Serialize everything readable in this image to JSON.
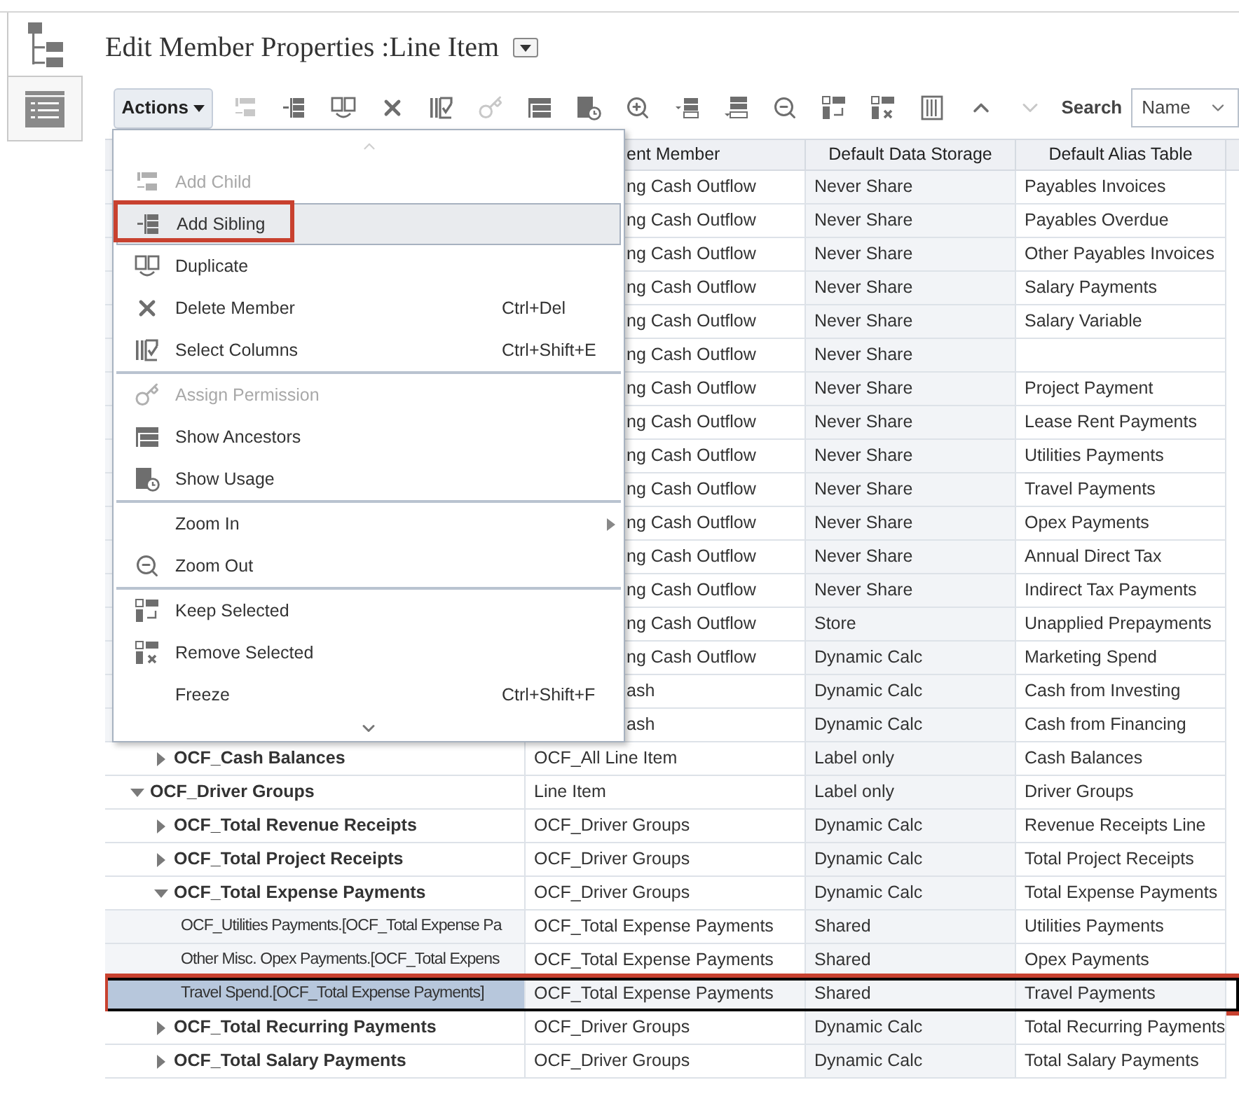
{
  "side_tabs": [
    {
      "selected": true
    },
    {
      "selected": false
    }
  ],
  "title": "Edit Member Properties :Line Item",
  "toolbar": {
    "actions": "Actions",
    "buttons": [
      {
        "disabled": true
      },
      {
        "disabled": false
      },
      {
        "disabled": false
      },
      {
        "disabled": false
      },
      {
        "disabled": false
      },
      {
        "disabled": true
      },
      {
        "disabled": false
      },
      {
        "disabled": false
      },
      {
        "disabled": false
      },
      {
        "disabled": false
      },
      {
        "disabled": false
      },
      {
        "disabled": false
      },
      {
        "disabled": false
      },
      {
        "disabled": false
      },
      {
        "disabled": false
      },
      {
        "disabled": false
      },
      {
        "disabled": true
      }
    ],
    "search_label": "Search",
    "search_by": "Name"
  },
  "table": {
    "columns": [
      "ent Member",
      "Default Data Storage",
      "Default Alias Table"
    ],
    "rows": [
      {
        "children": [
          {
            "parent": "ng Cash Outflow",
            "storage": "Never Share",
            "alias": "Payables Invoices",
            "selected": false,
            "annotated": false
          },
          {
            "parent": "ng Cash Outflow",
            "storage": "Never Share",
            "alias": "Payables Overdue",
            "selected": false,
            "annotated": false
          },
          {
            "parent": "ng Cash Outflow",
            "storage": "Never Share",
            "alias": "Other Payables Invoices",
            "selected": false,
            "annotated": false
          },
          {
            "parent": "ng Cash Outflow",
            "storage": "Never Share",
            "alias": "Salary Payments",
            "selected": false,
            "annotated": false
          },
          {
            "parent": "ng Cash Outflow",
            "storage": "Never Share",
            "alias": "Salary Variable",
            "selected": false,
            "annotated": false
          },
          {
            "parent": "ng Cash Outflow",
            "storage": "Never Share",
            "selected": false,
            "annotated": false
          },
          {
            "parent": "ng Cash Outflow",
            "storage": "Never Share",
            "alias": "Project Payment",
            "selected": false,
            "annotated": false
          },
          {
            "parent": "ng Cash Outflow",
            "storage": "Never Share",
            "alias": "Lease Rent Payments",
            "selected": false,
            "annotated": false
          },
          {
            "parent": "ng Cash Outflow",
            "storage": "Never Share",
            "alias": "Utilities Payments",
            "selected": false,
            "annotated": false
          },
          {
            "parent": "ng Cash Outflow",
            "storage": "Never Share",
            "alias": "Travel Payments",
            "selected": false,
            "annotated": false
          },
          {
            "parent": "ng Cash Outflow",
            "storage": "Never Share",
            "alias": "Opex Payments",
            "selected": false,
            "annotated": false
          },
          {
            "parent": "ng Cash Outflow",
            "storage": "Never Share",
            "alias": "Annual Direct Tax",
            "selected": false,
            "annotated": false
          },
          {
            "parent": "ng Cash Outflow",
            "storage": "Never Share",
            "alias": "Indirect Tax Payments",
            "selected": false,
            "annotated": false
          },
          {
            "parent": "ng Cash Outflow",
            "storage": "Store",
            "alias": "Unapplied Prepayments",
            "selected": false,
            "annotated": false
          },
          {
            "parent": "ng Cash Outflow",
            "storage": "Dynamic Calc",
            "alias": "Marketing Spend",
            "selected": false,
            "annotated": false
          },
          {
            "parent": "ash",
            "storage": "Dynamic Calc",
            "alias": "Cash from Investing",
            "selected": false,
            "annotated": false
          },
          {
            "parent": "ash",
            "storage": "Dynamic Calc",
            "alias": "Cash from Financing",
            "selected": false,
            "annotated": false
          },
          {
            "member": "OCF_Cash Balances",
            "expanded": false,
            "parent": "OCF_All Line Item",
            "storage": "Label only",
            "alias": "Cash Balances",
            "selected": false,
            "annotated": false
          }
        ]
      },
      {
        "member": "OCF_Driver Groups",
        "expanded": true,
        "parent": "Line Item",
        "storage": "Label only",
        "alias": "Driver Groups",
        "selected": false,
        "annotated": false,
        "children": [
          {
            "member": "OCF_Total Revenue Receipts",
            "expanded": false,
            "parent": "OCF_Driver Groups",
            "storage": "Dynamic Calc",
            "alias": "Revenue Receipts Line",
            "selected": false,
            "annotated": false
          },
          {
            "member": "OCF_Total Project Receipts",
            "expanded": false,
            "parent": "OCF_Driver Groups",
            "storage": "Dynamic Calc",
            "alias": "Total Project Receipts",
            "selected": false,
            "annotated": false
          },
          {
            "member": "OCF_Total Expense Payments",
            "expanded": true,
            "parent": "OCF_Driver Groups",
            "storage": "Dynamic Calc",
            "alias": "Total Expense Payments",
            "selected": false,
            "annotated": false,
            "children": [
              {
                "member": "OCF_Utilities Payments.[OCF_Total Expense Pa",
                "parent": "OCF_Total Expense Payments",
                "storage": "Shared",
                "alias": "Utilities Payments",
                "selected": false,
                "annotated": false
              },
              {
                "member": "Other Misc. Opex Payments.[OCF_Total Expens",
                "parent": "OCF_Total Expense Payments",
                "storage": "Shared",
                "alias": "Opex Payments",
                "selected": false,
                "annotated": false
              },
              {
                "member": "Travel Spend.[OCF_Total Expense Payments]",
                "parent": "OCF_Total Expense Payments",
                "storage": "Shared",
                "alias": "Travel Payments",
                "selected": true,
                "annotated": true
              }
            ]
          },
          {
            "member": "OCF_Total Recurring Payments",
            "expanded": false,
            "parent": "OCF_Driver Groups",
            "storage": "Dynamic Calc",
            "alias": "Total Recurring Payments",
            "selected": false,
            "annotated": false
          },
          {
            "member": "OCF_Total Salary Payments",
            "expanded": false,
            "parent": "OCF_Driver Groups",
            "storage": "Dynamic Calc",
            "alias": "Total Salary Payments",
            "selected": false,
            "annotated": false
          }
        ]
      }
    ]
  },
  "menu": {
    "groups": [
      [
        {
          "label": "Add Child",
          "disabled": true,
          "highlighted": false,
          "annotated": false
        },
        {
          "label": "Add Sibling",
          "disabled": false,
          "highlighted": true,
          "annotated": true
        },
        {
          "label": "Duplicate",
          "disabled": false,
          "highlighted": false,
          "annotated": false
        },
        {
          "label": "Delete Member",
          "shortcut": "Ctrl+Del",
          "disabled": false,
          "highlighted": false,
          "annotated": false
        },
        {
          "label": "Select Columns",
          "shortcut": "Ctrl+Shift+E",
          "disabled": false,
          "highlighted": false,
          "annotated": false
        }
      ],
      [
        {
          "label": "Assign Permission",
          "disabled": true,
          "highlighted": false,
          "annotated": false
        },
        {
          "label": "Show Ancestors",
          "disabled": false,
          "highlighted": false,
          "annotated": false
        },
        {
          "label": "Show Usage",
          "disabled": false,
          "highlighted": false,
          "annotated": false
        }
      ],
      [
        {
          "label": "Zoom In",
          "kind": "submenu",
          "disabled": false,
          "highlighted": false,
          "annotated": false
        },
        {
          "label": "Zoom Out",
          "kind": "command",
          "disabled": false,
          "highlighted": false,
          "annotated": false
        }
      ],
      [
        {
          "label": "Keep Selected",
          "disabled": false,
          "highlighted": false,
          "annotated": false
        },
        {
          "label": "Remove Selected",
          "disabled": false,
          "highlighted": false,
          "annotated": false
        },
        {
          "label": "Freeze",
          "shortcut": "Ctrl+Shift+F",
          "disabled": false,
          "highlighted": false,
          "annotated": false
        }
      ]
    ]
  }
}
